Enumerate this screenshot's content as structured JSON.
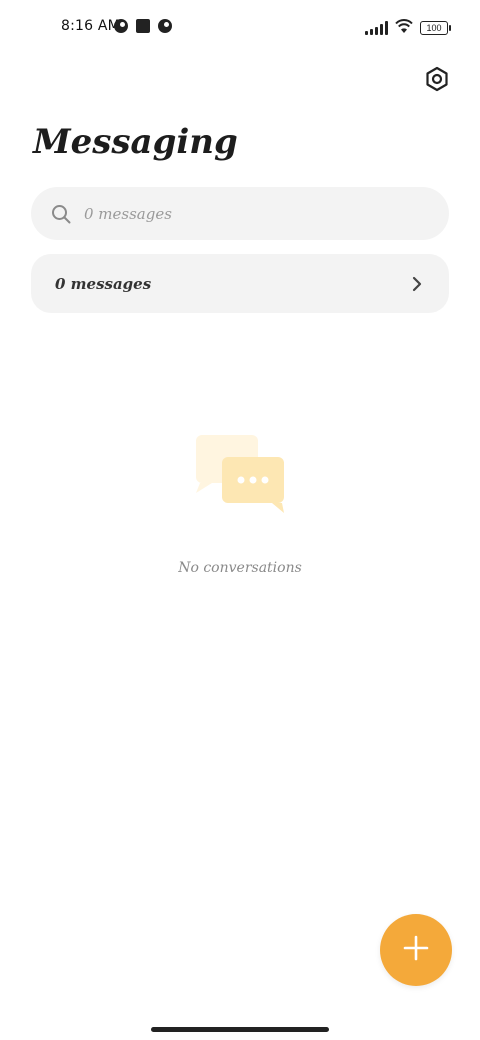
{
  "status_bar": {
    "time": "8:16 AM",
    "battery": "100",
    "icons": [
      "notification-icon",
      "square-icon",
      "notification-icon",
      "signal-icon",
      "wifi-icon",
      "battery-icon"
    ]
  },
  "header": {
    "title": "Messaging",
    "settings_icon": "settings-icon"
  },
  "search": {
    "placeholder": "0 messages",
    "value": ""
  },
  "messages_row": {
    "label": "0 messages",
    "icon": "chevron-right-icon"
  },
  "empty_state": {
    "text": "No conversations",
    "icon": "chat-bubbles-icon"
  },
  "fab": {
    "icon": "plus-icon",
    "color": "#f4a93a"
  },
  "colors": {
    "accent": "#f4a93a",
    "card_bg": "#f3f3f3",
    "illustration": "#fde7b3"
  }
}
